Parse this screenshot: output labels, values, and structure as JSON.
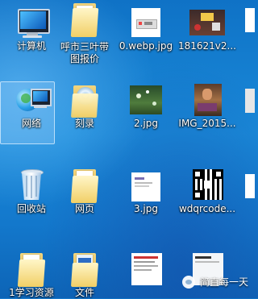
{
  "desktop": {
    "icons": [
      {
        "label": "计算机",
        "type": "computer"
      },
      {
        "label": "呼市三叶带\n图报价",
        "type": "folder"
      },
      {
        "label": "0.webp.jpg",
        "type": "image"
      },
      {
        "label": "181621v2...",
        "type": "image"
      },
      {
        "label": "网络",
        "type": "network"
      },
      {
        "label": "刻录",
        "type": "folder-disc"
      },
      {
        "label": "2.jpg",
        "type": "image"
      },
      {
        "label": "IMG_2015...",
        "type": "image"
      },
      {
        "label": "回收站",
        "type": "recycle-bin"
      },
      {
        "label": "网页",
        "type": "folder"
      },
      {
        "label": "3.jpg",
        "type": "image"
      },
      {
        "label": "wdqrcode...",
        "type": "image"
      },
      {
        "label": "1学习资源",
        "type": "folder"
      },
      {
        "label": "文件",
        "type": "folder-blue"
      },
      {
        "label": "",
        "type": "screenshot"
      },
      {
        "label": "",
        "type": "screenshot"
      }
    ]
  },
  "watermark": {
    "text": "简直每一天"
  },
  "colors": {
    "desktop": "#1a8ad9",
    "selection": "#b4dcff"
  }
}
